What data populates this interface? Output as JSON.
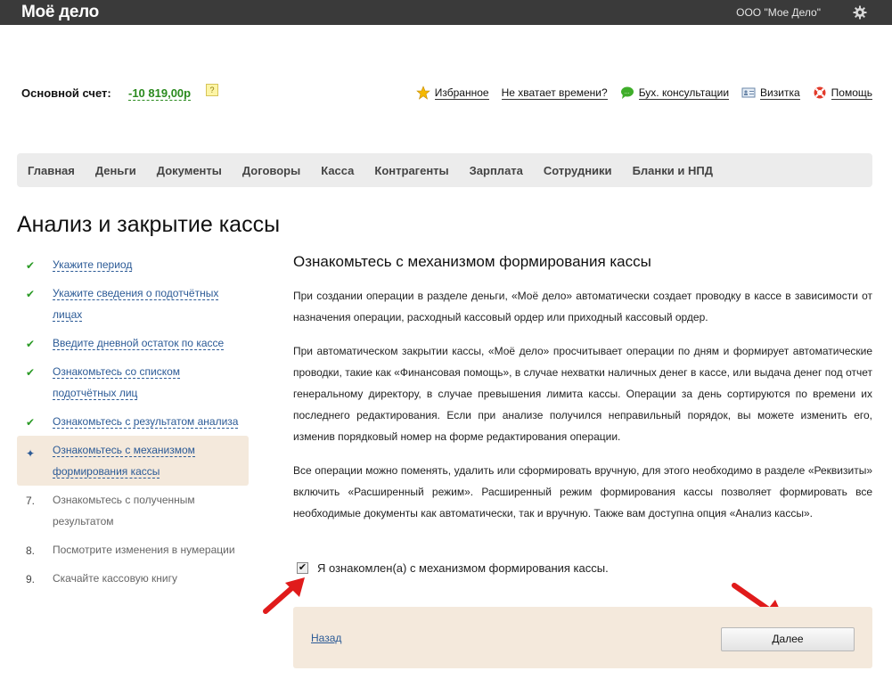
{
  "header": {
    "logo": "Моё дело",
    "company": "ООО \"Мое Дело\"",
    "settings_icon": "gear-icon"
  },
  "account": {
    "label": "Основной счет:",
    "balance": "-10 819,00р",
    "help": "?"
  },
  "top_links": [
    {
      "label": "Избранное",
      "icon": "star-icon"
    },
    {
      "label": "Не хватает времени?",
      "icon": ""
    },
    {
      "label": "Бух. консультации",
      "icon": "chat-icon"
    },
    {
      "label": "Визитка",
      "icon": "card-icon"
    },
    {
      "label": "Помощь",
      "icon": "lifebuoy-icon"
    }
  ],
  "menu": [
    "Главная",
    "Деньги",
    "Документы",
    "Договоры",
    "Касса",
    "Контрагенты",
    "Зарплата",
    "Сотрудники",
    "Бланки и НПД"
  ],
  "page_title": "Анализ и закрытие кассы",
  "steps": [
    {
      "status": "done",
      "label": "Укажите период"
    },
    {
      "status": "done",
      "label": "Укажите сведения о подотчётных лицах"
    },
    {
      "status": "done",
      "label": "Введите дневной остаток по кассе"
    },
    {
      "status": "done",
      "label": "Ознакомьтесь со списком подотчётных лиц"
    },
    {
      "status": "done",
      "label": "Ознакомьтесь с результатом анализа"
    },
    {
      "status": "current",
      "label": "Ознакомьтесь с механизмом формирования кассы"
    },
    {
      "status": "pending",
      "num": "7.",
      "label": "Ознакомьтесь с полученным результатом"
    },
    {
      "status": "pending",
      "num": "8.",
      "label": "Посмотрите изменения в нумерации"
    },
    {
      "status": "pending",
      "num": "9.",
      "label": "Скачайте кассовую книгу"
    }
  ],
  "content": {
    "heading": "Ознакомьтесь с механизмом формирования кассы",
    "p1": "При создании операции в разделе деньги, «Моё дело» автоматически создает проводку в кассе в зависимости от назначения операции, расходный кассовый ордер или приходный кассовый ордер.",
    "p2": "При автоматическом закрытии кассы, «Моё дело» просчитывает операции по дням и формирует автоматические проводки, такие как «Финансовая помощь», в случае нехватки наличных денег в кассе, или выдача денег под отчет генеральному директору, в случае превышения лимита кассы. Операции за день сортируются по времени их последнего редактирования. Если при анализе получился неправильный порядок, вы можете изменить его, изменив порядковый номер на форме редактирования операции.",
    "p3": "Все операции можно поменять, удалить или сформировать вручную, для этого необходимо в разделе «Реквизиты» включить «Расширенный режим». Расширенный режим формирования кассы позволяет формировать все необходимые документы как автоматически, так и вручную. Также вам доступна опция «Анализ кассы».",
    "agree_label": "Я ознакомлен(а) с механизмом формирования кассы.",
    "agree_checked": true
  },
  "footer": {
    "back": "Назад",
    "next": "Далее"
  },
  "colors": {
    "topbar": "#3a3a3a",
    "balance": "#2a8a1e",
    "link": "#2b5a96",
    "current_step_bg": "#f4e9dc",
    "annotation_arrow": "#e01b1b"
  }
}
